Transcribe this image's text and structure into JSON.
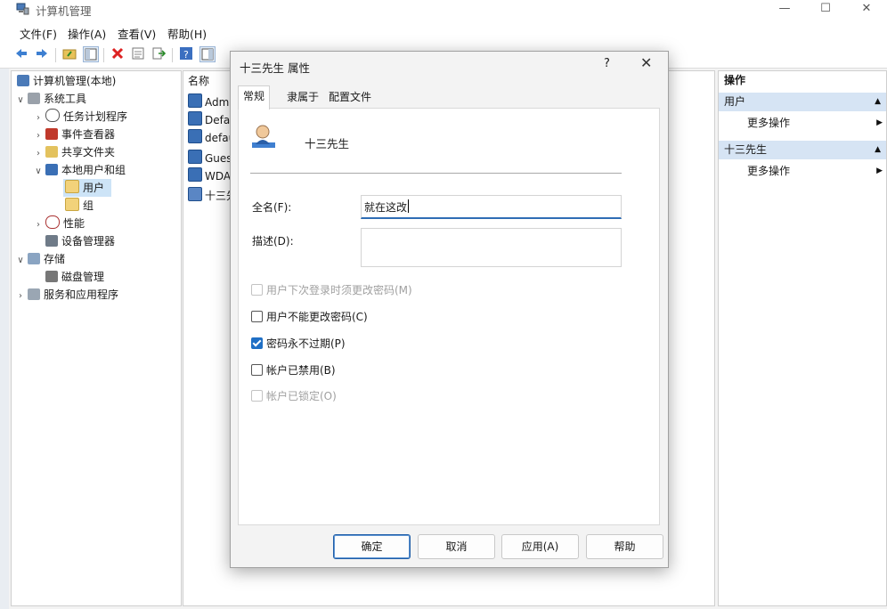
{
  "window": {
    "title": "计算机管理",
    "minimize": "—",
    "maximize": "☐",
    "close": "✕"
  },
  "menu": [
    "文件(F)",
    "操作(A)",
    "查看(V)",
    "帮助(H)"
  ],
  "tree": [
    {
      "label": "计算机管理(本地)"
    },
    {
      "label": "系统工具"
    },
    {
      "label": "任务计划程序"
    },
    {
      "label": "事件查看器"
    },
    {
      "label": "共享文件夹"
    },
    {
      "label": "本地用户和组"
    },
    {
      "label": "用户"
    },
    {
      "label": "组"
    },
    {
      "label": "性能"
    },
    {
      "label": "设备管理器"
    },
    {
      "label": "存储"
    },
    {
      "label": "磁盘管理"
    },
    {
      "label": "服务和应用程序"
    }
  ],
  "list": {
    "header": "名称",
    "rows": [
      "Admi",
      "Defau",
      "defau",
      "Gues",
      "WDA",
      "十三先"
    ]
  },
  "actions": {
    "header": "操作",
    "groups": [
      {
        "title": "用户",
        "item": "更多操作"
      },
      {
        "title": "十三先生",
        "item": "更多操作"
      }
    ]
  },
  "dialog": {
    "title": "十三先生 属性",
    "help": "?",
    "close": "✕",
    "tabs": [
      "常规",
      "隶属于",
      "配置文件"
    ],
    "user_name": "十三先生",
    "fullname_label": "全名(F):",
    "fullname_value": "就在这改",
    "description_label": "描述(D):",
    "description_value": "",
    "checkboxes": [
      {
        "label": "用户下次登录时须更改密码(M)",
        "checked": false,
        "disabled": true
      },
      {
        "label": "用户不能更改密码(C)",
        "checked": false,
        "disabled": false
      },
      {
        "label": "密码永不过期(P)",
        "checked": true,
        "disabled": false
      },
      {
        "label": "帐户已禁用(B)",
        "checked": false,
        "disabled": false
      },
      {
        "label": "帐户已锁定(O)",
        "checked": false,
        "disabled": true
      }
    ],
    "buttons": {
      "ok": "确定",
      "cancel": "取消",
      "apply": "应用(A)",
      "help": "帮助"
    }
  },
  "colors": {
    "accent": "#1f6fc5",
    "selection": "#cde4f7",
    "action_header": "#d6e4f4"
  }
}
